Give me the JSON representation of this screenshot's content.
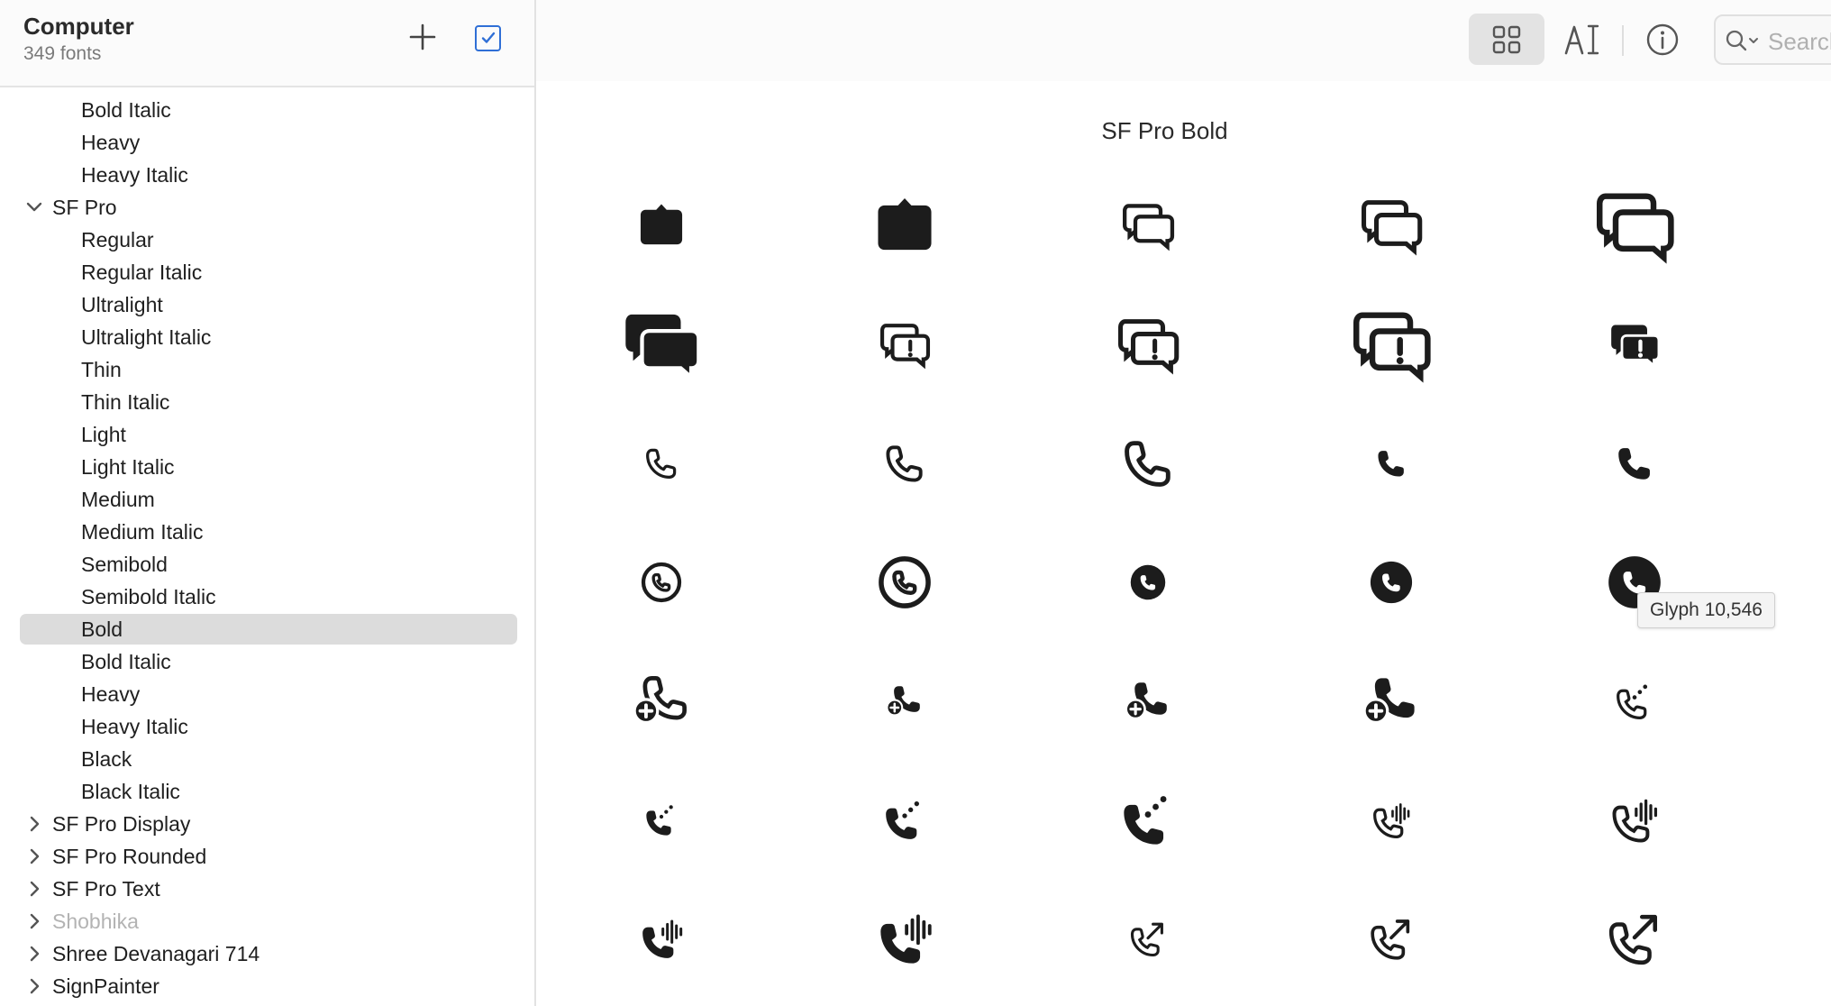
{
  "sidebar": {
    "title": "Computer",
    "subtitle": "349 fonts",
    "add_button_icon": "plus-icon",
    "select_checkbox_icon": "checkbox-checked-icon",
    "items": [
      {
        "label": "Bold Italic",
        "level": "style"
      },
      {
        "label": "Heavy",
        "level": "style"
      },
      {
        "label": "Heavy Italic",
        "level": "style"
      },
      {
        "label": "SF Pro",
        "level": "family",
        "expanded": true
      },
      {
        "label": "Regular",
        "level": "style"
      },
      {
        "label": "Regular Italic",
        "level": "style"
      },
      {
        "label": "Ultralight",
        "level": "style"
      },
      {
        "label": "Ultralight Italic",
        "level": "style"
      },
      {
        "label": "Thin",
        "level": "style"
      },
      {
        "label": "Thin Italic",
        "level": "style"
      },
      {
        "label": "Light",
        "level": "style"
      },
      {
        "label": "Light Italic",
        "level": "style"
      },
      {
        "label": "Medium",
        "level": "style"
      },
      {
        "label": "Medium Italic",
        "level": "style"
      },
      {
        "label": "Semibold",
        "level": "style"
      },
      {
        "label": "Semibold Italic",
        "level": "style"
      },
      {
        "label": "Bold",
        "level": "style",
        "selected": true
      },
      {
        "label": "Bold Italic",
        "level": "style"
      },
      {
        "label": "Heavy",
        "level": "style"
      },
      {
        "label": "Heavy Italic",
        "level": "style"
      },
      {
        "label": "Black",
        "level": "style"
      },
      {
        "label": "Black Italic",
        "level": "style"
      },
      {
        "label": "SF Pro Display",
        "level": "family",
        "expanded": false
      },
      {
        "label": "SF Pro Rounded",
        "level": "family",
        "expanded": false
      },
      {
        "label": "SF Pro Text",
        "level": "family",
        "expanded": false
      },
      {
        "label": "Shobhika",
        "level": "family",
        "expanded": false,
        "dimmed": true
      },
      {
        "label": "Shree Devanagari 714",
        "level": "family",
        "expanded": false
      },
      {
        "label": "SignPainter",
        "level": "family",
        "expanded": false
      }
    ]
  },
  "toolbar": {
    "buttons": [
      {
        "name": "sample-view-button",
        "icon": "text-align-center-icon",
        "active": false
      },
      {
        "name": "grid-view-button",
        "icon": "grid-icon",
        "active": true
      },
      {
        "name": "custom-view-button",
        "icon": "text-cursor-icon",
        "active": false
      },
      {
        "name": "info-button",
        "icon": "info-circle-icon",
        "active": false
      }
    ],
    "search_placeholder": "Search"
  },
  "content": {
    "font_title": "SF Pro Bold",
    "tooltip": "Glyph 10,546",
    "glyphs": [
      [
        "bubble-small-filled-icon",
        "bubble-large-filled-icon",
        "bubbles-outline-small-icon",
        "bubbles-outline-medium-icon",
        "bubbles-outline-large-icon"
      ],
      [
        "bubbles-filled-large-icon",
        "bubbles-exclamation-small-icon",
        "bubbles-exclamation-medium-icon",
        "bubbles-exclamation-large-icon",
        "bubbles-exclamation-filled-icon"
      ],
      [
        "phone-outline-small-icon",
        "phone-outline-medium-icon",
        "phone-outline-large-icon",
        "phone-filled-small-icon",
        "phone-filled-medium-icon"
      ],
      [
        "phone-circle-outline-small-icon",
        "phone-circle-outline-large-icon",
        "phone-circle-filled-small-icon",
        "phone-circle-filled-medium-icon",
        "phone-circle-filled-large-icon"
      ],
      [
        "phone-plus-outline-icon",
        "phone-plus-filled-small-icon",
        "phone-plus-filled-medium-icon",
        "phone-plus-filled-large-icon",
        "phone-dots-outline-icon"
      ],
      [
        "phone-dots-small-icon",
        "phone-dots-medium-icon",
        "phone-dots-large-icon",
        "phone-waveform-outline-small-icon",
        "phone-waveform-outline-large-icon"
      ],
      [
        "phone-waveform-filled-small-icon",
        "phone-waveform-filled-large-icon",
        "phone-arrow-outline-small-icon",
        "phone-arrow-outline-medium-icon",
        "phone-arrow-outline-large-icon"
      ]
    ]
  },
  "colors": {
    "accent": "#2f6fd6",
    "selection": "#dcdcdc",
    "glyph": "#1c1c1c"
  }
}
